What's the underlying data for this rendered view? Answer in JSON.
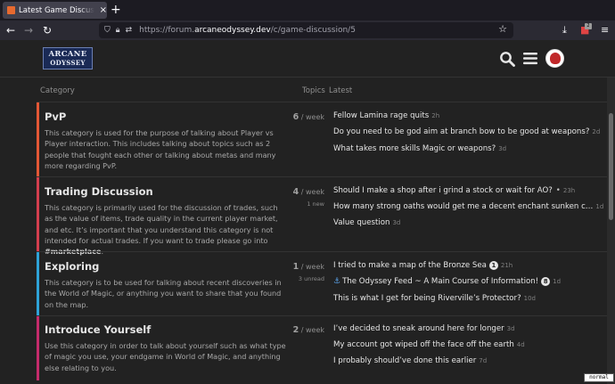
{
  "browser": {
    "tab_title": "Latest Game Discussion t",
    "tab_close": "×",
    "new_tab": "+",
    "url_prefix": "https://forum.",
    "url_domain": "arcaneodyssey.dev",
    "url_path": "/c/game-discussion/5",
    "ext_badge_count": "2"
  },
  "site": {
    "logo_line1": "ARCANE",
    "logo_line2": "ODYSSEY"
  },
  "columns": {
    "category": "Category",
    "topics": "Topics",
    "latest": "Latest"
  },
  "categories": [
    {
      "name": "PvP",
      "color": "#e45735",
      "description": "This category is used for the purpose of talking about Player vs Player interaction. This includes talking about topics such as 2 people that fought each other or talking about metas and many more regarding PvP.",
      "count": "6",
      "per": "/ week",
      "sub": "",
      "topics": [
        {
          "title": "Fellow Lamina rage quits",
          "age": "2h"
        },
        {
          "title": "Do you need to be god aim at branch bow to be good at weapons?",
          "age": "2d"
        },
        {
          "title": "What takes more skills Magic or weapons?",
          "age": "3d"
        }
      ]
    },
    {
      "name": "Trading Discussion",
      "color": "#d43e4e",
      "description_pre": "This category is primarily used for the discussion of trades, such as the value of items, trade quality in the current player market, and etc. It’s important that you understand this category is not intended for actual trades. If you want to trade please go into ",
      "description_link": "#marketplace",
      "description_post": ".",
      "count": "4",
      "per": "/ week",
      "sub": "1 new",
      "topics": [
        {
          "title": "Should I make a shop after i grind a stock or wait for AO?",
          "age": "23h"
        },
        {
          "title": "How many strong oaths would get me a decent enchant sunken c…",
          "age": "1d"
        },
        {
          "title": "Value question",
          "age": "3d"
        }
      ]
    },
    {
      "name": "Exploring",
      "color": "#2ea3d8",
      "description": "This category is to be used for talking about recent discoveries in the World of Magic, or anything you want to share that you found on the map.",
      "count": "1",
      "per": "/ week",
      "sub": "3 unread",
      "topics": [
        {
          "title": "I tried to make a map of the Bronze Sea",
          "badge": "1",
          "age": "21h"
        },
        {
          "title": "The Odyssey Feed ~ A Main Course of Information!",
          "badge": "8",
          "age": "1d"
        },
        {
          "title": "This is what I get for being Riverville’s Protector?",
          "age": "10d"
        }
      ]
    },
    {
      "name": "Introduce Yourself",
      "color": "#c52b6b",
      "description": "Use this category in order to talk about yourself such as what type of magic you use, your endgame in World of Magic, and anything else relating to you.",
      "count": "2",
      "per": "/ week",
      "sub": "",
      "topics": [
        {
          "title": "I’ve decided to sneak around here for longer",
          "age": "3d"
        },
        {
          "title": "My account got wiped off the face off the earth",
          "age": "4d"
        },
        {
          "title": "I probably should’ve done this earlier",
          "age": "7d"
        }
      ]
    }
  ],
  "mode_tag": "normal"
}
